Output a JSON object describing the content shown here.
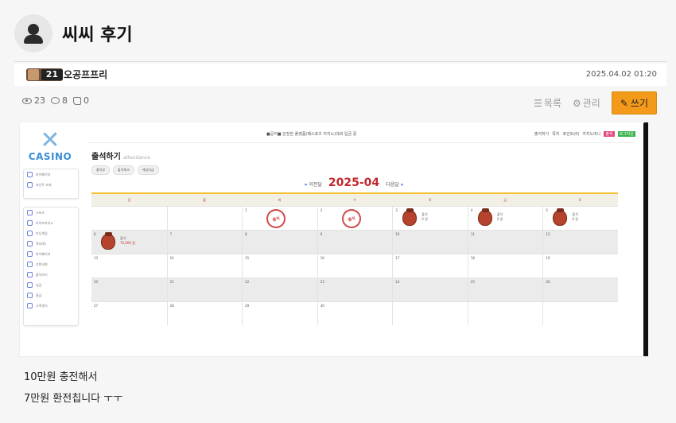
{
  "post": {
    "title": "씨씨 후기",
    "author_level": "21",
    "author": "오공프프리",
    "date": "2025.04.02 01:20",
    "views": "23",
    "comments": "8",
    "likes": "0",
    "body_lines": [
      "10만원 충전해서",
      "7만원 환전칩니다 ㅜㅜ"
    ]
  },
  "actions": {
    "list_label": "목록",
    "manage_label": "관리",
    "write_label": "쓰기"
  },
  "screenshot": {
    "logo_text": "CASINO",
    "topbar_text": "■공지■ 안전한 플랫폼(페스포츠 카지노)대비 입금 중",
    "topbar_items": [
      "출석하기",
      "쪽지",
      "포인트(0)",
      "카지노머니"
    ],
    "tag_red": "출석",
    "tag_green": "로그아웃",
    "side_top": [
      "마이페이지",
      "포인트 조회"
    ],
    "side_items": [
      "스포츠",
      "라이브카지노",
      "미니게임",
      "쪽지(0)",
      "마이페이지",
      "추천내역",
      "출석하기",
      "입금",
      "환급",
      "고객센터"
    ],
    "page_title": "출석하기",
    "page_subtitle": "attendance",
    "tabs": [
      "출석부",
      "출석체크",
      "게임지급"
    ],
    "prev": "이전달",
    "year_month": "2025-04",
    "next": "다음달",
    "weekdays": [
      "일",
      "월",
      "화",
      "수",
      "목",
      "금",
      "토"
    ],
    "stamp_text": "출석",
    "bag_text": "출석",
    "bag_sub": "0 원",
    "bag_red": "70,000 원",
    "weeks": [
      [
        "",
        "",
        "1",
        "2",
        "3",
        "4",
        "5"
      ],
      [
        "6",
        "7",
        "8",
        "9",
        "10",
        "11",
        "12"
      ],
      [
        "13",
        "14",
        "15",
        "16",
        "17",
        "18",
        "19"
      ],
      [
        "20",
        "21",
        "22",
        "23",
        "24",
        "25",
        "26"
      ],
      [
        "27",
        "28",
        "29",
        "30",
        "",
        "",
        ""
      ]
    ]
  }
}
